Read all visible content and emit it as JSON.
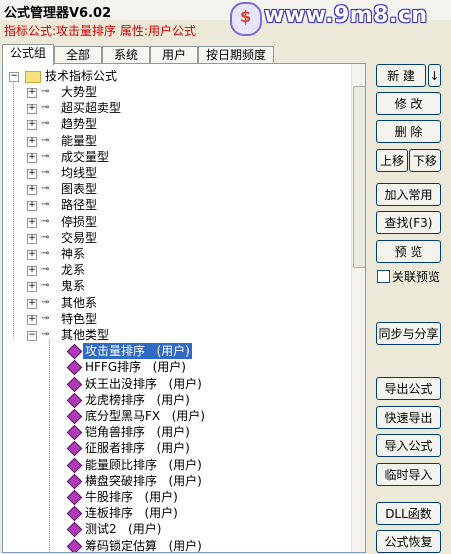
{
  "window": {
    "title": "公式管理器V6.02"
  },
  "watermark": {
    "text": "www.9m8.cn"
  },
  "info": {
    "prefix": "指标公式:",
    "name": "攻击量排序",
    "attr_label": "属性:",
    "attr_value": "用户公式"
  },
  "tabs": [
    "公式组",
    "全部",
    "系统",
    "用户",
    "按日期频度"
  ],
  "tree": {
    "root": "技术指标公式",
    "groups": [
      "大势型",
      "超买超卖型",
      "趋势型",
      "能量型",
      "成交量型",
      "均线型",
      "图表型",
      "路径型",
      "停损型",
      "交易型",
      "神系",
      "龙系",
      "鬼系",
      "其他系",
      "特色型",
      "其他类型"
    ],
    "formulas": [
      {
        "name": "攻击量排序",
        "attr": "(用户)"
      },
      {
        "name": "HFFG排序",
        "attr": "(用户)"
      },
      {
        "name": "妖王出没排序",
        "attr": "(用户)"
      },
      {
        "name": "龙虎榜排序",
        "attr": "(用户)"
      },
      {
        "name": "底分型黑马FX",
        "attr": "(用户)"
      },
      {
        "name": "铠角兽排序",
        "attr": "(用户)"
      },
      {
        "name": "征服者排序",
        "attr": "(用户)"
      },
      {
        "name": "能量顾比排序",
        "attr": "(用户)"
      },
      {
        "name": "横盘突破排序",
        "attr": "(用户)"
      },
      {
        "name": "牛股排序",
        "attr": "(用户)"
      },
      {
        "name": "连板排序",
        "attr": "(用户)"
      },
      {
        "name": "测试2",
        "attr": "(用户)"
      },
      {
        "name": "筹码锁定估算",
        "attr": "(用户)"
      }
    ]
  },
  "buttons": {
    "new": "新 建",
    "new_arrow": "↓",
    "modify": "修 改",
    "delete": "删 除",
    "move_up": "上移",
    "move_down": "下移",
    "add_common": "加入常用",
    "find": "查找(F3)",
    "preview": "预 览",
    "link_preview": "关联预览",
    "sync_share": "同步与分享",
    "export": "导出公式",
    "quick_export": "快速导出",
    "import": "导入公式",
    "temp_import": "临时导入",
    "dll": "DLL函数",
    "restore": "公式恢复"
  }
}
